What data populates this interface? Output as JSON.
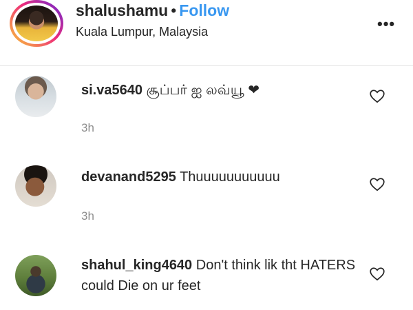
{
  "post_header": {
    "username": "shalushamu",
    "separator": "•",
    "follow_label": "Follow",
    "location": "Kuala Lumpur, Malaysia",
    "more_icon": "more-options-icon",
    "more_label": "•••"
  },
  "comments": [
    {
      "username": "si.va5640",
      "text": "சூப்பர் ஐ லவ்யூ ❤",
      "time": "3h",
      "like_icon": "heart-icon"
    },
    {
      "username": "devanand5295",
      "text": "Thuuuuuuuuuuu",
      "time": "3h",
      "like_icon": "heart-icon"
    },
    {
      "username": "shahul_king4640",
      "text": "Don't think lik tht HATERS could Die on ur feet",
      "like_icon": "heart-icon"
    }
  ]
}
